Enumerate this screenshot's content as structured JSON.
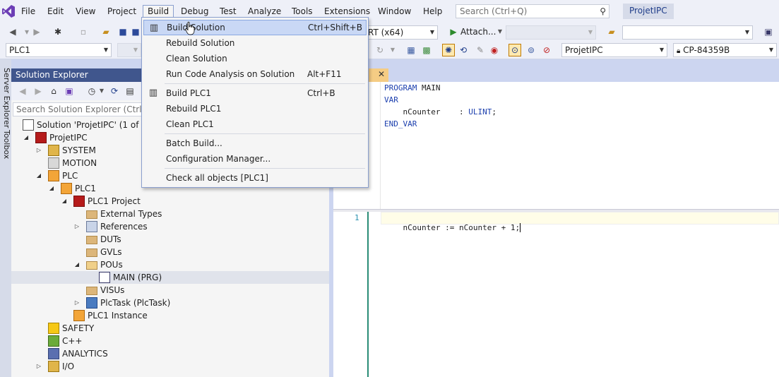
{
  "menubar": {
    "items": [
      "File",
      "Edit",
      "View",
      "Project",
      "Build",
      "Debug",
      "Test",
      "Analyze",
      "Tools",
      "Extensions",
      "Window",
      "Help"
    ],
    "search_placeholder": "Search (Ctrl+Q)",
    "project_title": "ProjetIPC"
  },
  "toolbar": {
    "platform_partial": "RT (x64)",
    "attach_label": "Attach...",
    "plc_combo": "PLC1",
    "project_combo": "ProjetIPC",
    "target_combo": "CP-84359B"
  },
  "side_tabs": [
    "Server Explorer",
    "Toolbox"
  ],
  "solution_explorer": {
    "title": "Solution Explorer",
    "search_placeholder": "Search Solution Explorer (Ctrl+$)",
    "tree": [
      {
        "label": "Solution 'ProjetIPC' (1 of 1 p",
        "depth": 0,
        "expander": "",
        "icon": "solution-icon"
      },
      {
        "label": "ProjetIPC",
        "depth": 1,
        "expander": "open",
        "icon": "twincat-project-icon"
      },
      {
        "label": "SYSTEM",
        "depth": 2,
        "expander": "closed",
        "icon": "system-icon"
      },
      {
        "label": "MOTION",
        "depth": 2,
        "expander": "",
        "icon": "motion-icon"
      },
      {
        "label": "PLC",
        "depth": 2,
        "expander": "open",
        "icon": "plc-icon"
      },
      {
        "label": "PLC1",
        "depth": 3,
        "expander": "open",
        "icon": "plc-icon"
      },
      {
        "label": "PLC1 Project",
        "depth": 4,
        "expander": "open",
        "icon": "plc-project-icon"
      },
      {
        "label": "External Types",
        "depth": 5,
        "expander": "",
        "icon": "folder-icon"
      },
      {
        "label": "References",
        "depth": 5,
        "expander": "closed",
        "icon": "references-icon"
      },
      {
        "label": "DUTs",
        "depth": 5,
        "expander": "",
        "icon": "folder-icon"
      },
      {
        "label": "GVLs",
        "depth": 5,
        "expander": "",
        "icon": "folder-icon"
      },
      {
        "label": "POUs",
        "depth": 5,
        "expander": "open",
        "icon": "folder-open-icon"
      },
      {
        "label": "MAIN (PRG)",
        "depth": 6,
        "expander": "",
        "icon": "program-icon",
        "selected": true
      },
      {
        "label": "VISUs",
        "depth": 5,
        "expander": "",
        "icon": "folder-icon"
      },
      {
        "label": "PlcTask (PlcTask)",
        "depth": 5,
        "expander": "closed",
        "icon": "task-icon"
      },
      {
        "label": "PLC1 Instance",
        "depth": 4,
        "expander": "",
        "icon": "plc-instance-icon"
      },
      {
        "label": "SAFETY",
        "depth": 2,
        "expander": "",
        "icon": "safety-icon"
      },
      {
        "label": "C++",
        "depth": 2,
        "expander": "",
        "icon": "cpp-icon"
      },
      {
        "label": "ANALYTICS",
        "depth": 2,
        "expander": "",
        "icon": "analytics-icon"
      },
      {
        "label": "I/O",
        "depth": 2,
        "expander": "closed",
        "icon": "io-icon"
      }
    ]
  },
  "editor": {
    "declaration_lines": [
      {
        "kw": "PROGRAM",
        "text": " MAIN"
      },
      {
        "kw": "VAR",
        "text": ""
      },
      {
        "kw": "",
        "text": "    nCounter    : ",
        "type": "ULINT",
        "end": ";"
      },
      {
        "kw": "END_VAR",
        "text": ""
      }
    ],
    "implementation_line_number": "1",
    "implementation_code": "nCounter := nCounter + 1;"
  },
  "build_menu": {
    "items": [
      {
        "label": "Build Solution",
        "shortcut": "Ctrl+Shift+B",
        "icon": "build-icon",
        "hover": true
      },
      {
        "label": "Rebuild Solution",
        "shortcut": ""
      },
      {
        "label": "Clean Solution",
        "shortcut": ""
      },
      {
        "label": "Run Code Analysis on Solution",
        "shortcut": "Alt+F11"
      },
      {
        "sep": true
      },
      {
        "label": "Build PLC1",
        "shortcut": "Ctrl+B",
        "icon": "build-icon"
      },
      {
        "label": "Rebuild PLC1",
        "shortcut": ""
      },
      {
        "label": "Clean PLC1",
        "shortcut": ""
      },
      {
        "sep": true
      },
      {
        "label": "Batch Build...",
        "shortcut": ""
      },
      {
        "label": "Configuration Manager...",
        "shortcut": ""
      },
      {
        "sep": true
      },
      {
        "label": "Check all objects [PLC1]",
        "shortcut": ""
      }
    ]
  },
  "colors": {
    "title_bar": "#40568d",
    "keyword": "#1c3fae",
    "active_tab": "#f5cc84",
    "menu_hover": "#c9d8f5"
  }
}
